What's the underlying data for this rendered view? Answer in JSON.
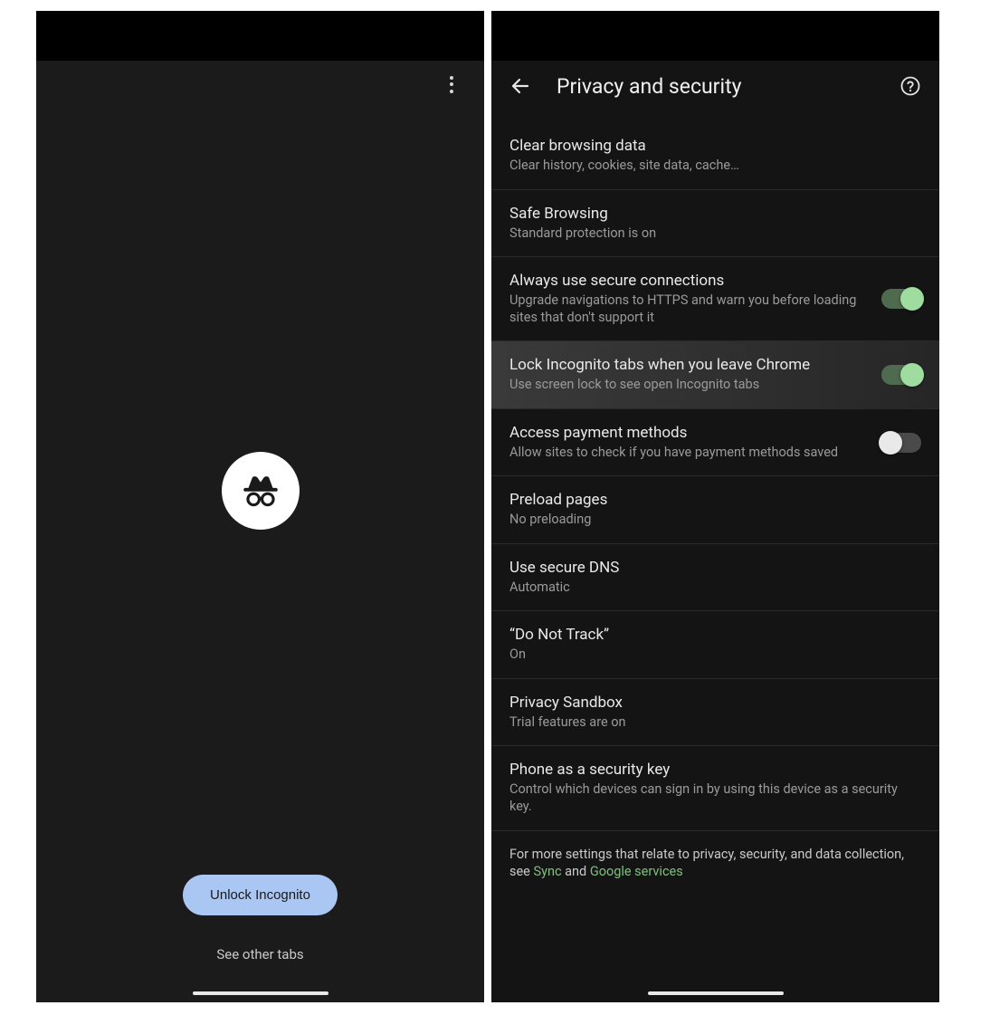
{
  "left": {
    "unlock_label": "Unlock Incognito",
    "see_other_label": "See other tabs",
    "incognito_icon": "incognito-icon"
  },
  "right": {
    "header_title": "Privacy and security",
    "items": [
      {
        "title": "Clear browsing data",
        "sub": "Clear history, cookies, site data, cache…",
        "toggle": null,
        "highlight": false
      },
      {
        "title": "Safe Browsing",
        "sub": "Standard protection is on",
        "toggle": null,
        "highlight": false
      },
      {
        "title": "Always use secure connections",
        "sub": "Upgrade navigations to HTTPS and warn you before loading sites that don't support it",
        "toggle": true,
        "highlight": false
      },
      {
        "title": "Lock Incognito tabs when you leave Chrome",
        "sub": "Use screen lock to see open Incognito tabs",
        "toggle": true,
        "highlight": true
      },
      {
        "title": "Access payment methods",
        "sub": "Allow sites to check if you have payment methods saved",
        "toggle": false,
        "highlight": false
      },
      {
        "title": "Preload pages",
        "sub": "No preloading",
        "toggle": null,
        "highlight": false
      },
      {
        "title": "Use secure DNS",
        "sub": "Automatic",
        "toggle": null,
        "highlight": false
      },
      {
        "title": "“Do Not Track”",
        "sub": "On",
        "toggle": null,
        "highlight": false
      },
      {
        "title": "Privacy Sandbox",
        "sub": "Trial features are on",
        "toggle": null,
        "highlight": false
      },
      {
        "title": "Phone as a security key",
        "sub": "Control which devices can sign in by using this device as a security key.",
        "toggle": null,
        "highlight": false
      }
    ],
    "footer_prefix": "For more settings that relate to privacy, security, and data collection, see ",
    "footer_link1": "Sync",
    "footer_mid": " and ",
    "footer_link2": "Google services"
  }
}
